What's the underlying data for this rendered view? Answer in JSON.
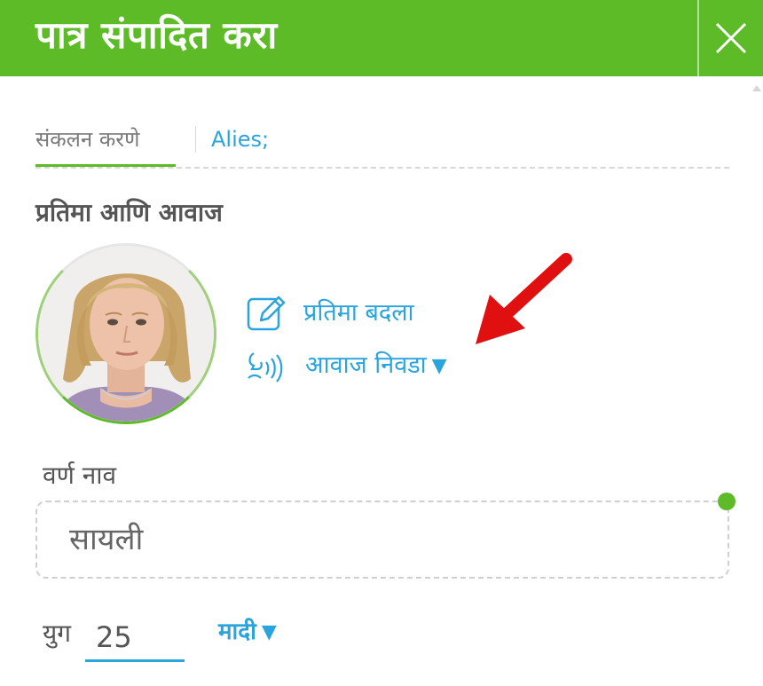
{
  "header": {
    "title": "पात्र संपादित करा",
    "accent_color": "#5dbb28",
    "close_icon": "close-icon"
  },
  "tabs": [
    {
      "label": "संकलन करणे",
      "active": true
    },
    {
      "label": "Alies;",
      "active": false
    }
  ],
  "section": {
    "title": "प्रतिमा आणि आवाज"
  },
  "avatar": {
    "icon": "character-portrait"
  },
  "actions": {
    "change_image": {
      "label": "प्रतिमा बदला",
      "icon": "edit-icon"
    },
    "select_voice": {
      "label": "आवाज निवडा",
      "caret": "▼",
      "icon": "voice-icon"
    }
  },
  "annotation": {
    "icon": "red-arrow-icon",
    "color": "#e01010"
  },
  "name_field": {
    "label": "वर्ण नाव",
    "value": "सायली"
  },
  "age_field": {
    "label": "युग",
    "value": "25"
  },
  "gender_select": {
    "value": "मादी",
    "caret": "▼"
  },
  "link_color": "#2aa4dc"
}
